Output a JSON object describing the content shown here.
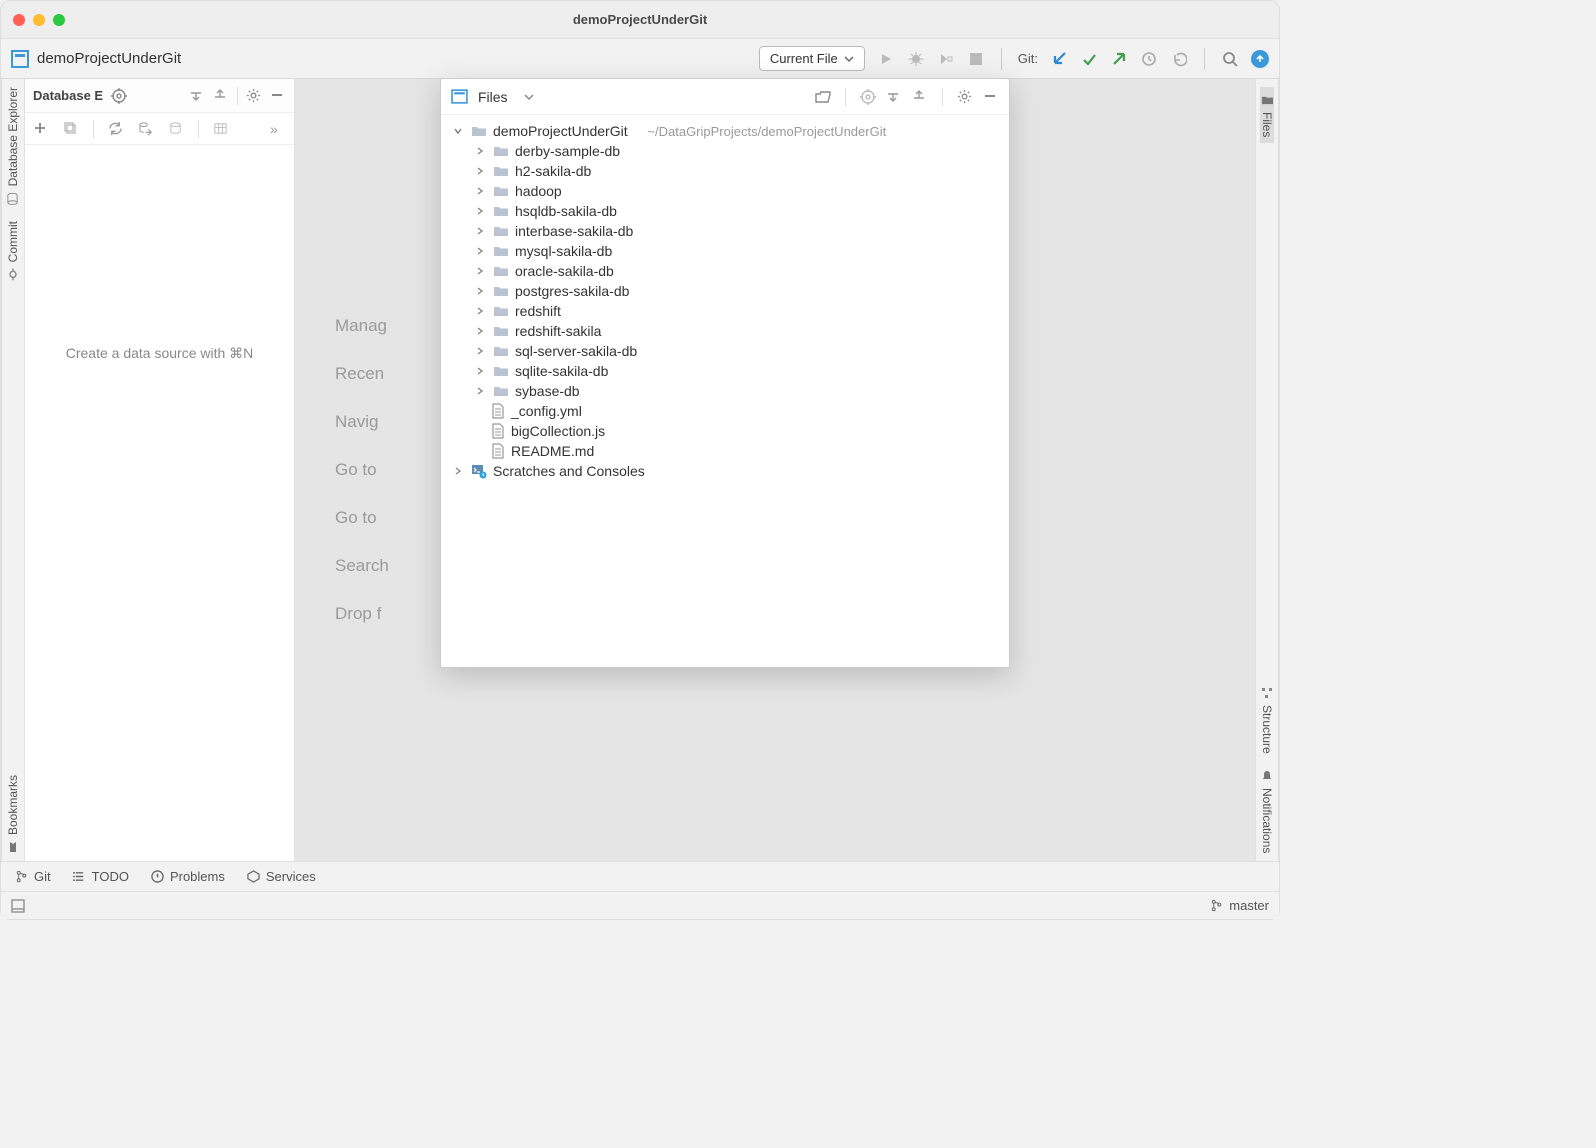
{
  "window": {
    "title": "demoProjectUnderGit"
  },
  "toolbar": {
    "project_name": "demoProjectUnderGit",
    "config_label": "Current File",
    "git_label": "Git:"
  },
  "leftStripe": {
    "dbExplorer": "Database Explorer",
    "commit": "Commit",
    "bookmarks": "Bookmarks"
  },
  "rightStripe": {
    "files": "Files",
    "structure": "Structure",
    "notifications": "Notifications"
  },
  "dbPanel": {
    "title": "Database E",
    "placeholder": "Create a data source with ⌘N"
  },
  "editor": {
    "r1": "Manag",
    "r2": "Recen",
    "r3": "Navig",
    "r4": "Go to",
    "r5": "Go to",
    "r6": "Search",
    "r7": "Drop f"
  },
  "filesPanel": {
    "title": "Files",
    "root": "demoProjectUnderGit",
    "rootPath": "~/DataGripProjects/demoProjectUnderGit",
    "folders": [
      "derby-sample-db",
      "h2-sakila-db",
      "hadoop",
      "hsqldb-sakila-db",
      "interbase-sakila-db",
      "mysql-sakila-db",
      "oracle-sakila-db",
      "postgres-sakila-db",
      "redshift",
      "redshift-sakila",
      "sql-server-sakila-db",
      "sqlite-sakila-db",
      "sybase-db"
    ],
    "files": [
      "_config.yml",
      "bigCollection.js",
      "README.md"
    ],
    "scratches": "Scratches and Consoles"
  },
  "bottomTabs": {
    "git": "Git",
    "todo": "TODO",
    "problems": "Problems",
    "services": "Services"
  },
  "status": {
    "branch": "master"
  }
}
